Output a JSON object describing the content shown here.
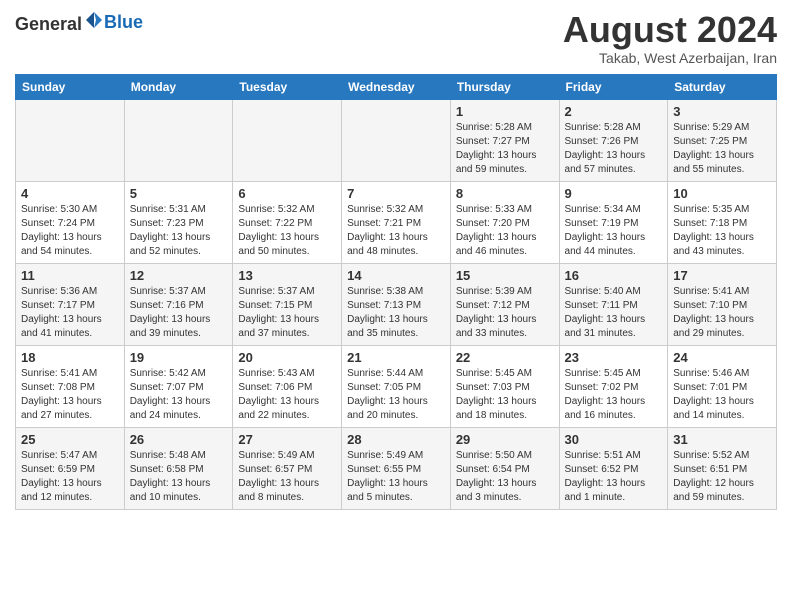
{
  "header": {
    "logo": {
      "text_general": "General",
      "text_blue": "Blue",
      "tagline": ""
    },
    "title": "August 2024",
    "location": "Takab, West Azerbaijan, Iran"
  },
  "calendar": {
    "days_of_week": [
      "Sunday",
      "Monday",
      "Tuesday",
      "Wednesday",
      "Thursday",
      "Friday",
      "Saturday"
    ],
    "weeks": [
      [
        {
          "day": "",
          "info": ""
        },
        {
          "day": "",
          "info": ""
        },
        {
          "day": "",
          "info": ""
        },
        {
          "day": "",
          "info": ""
        },
        {
          "day": "1",
          "info": "Sunrise: 5:28 AM\nSunset: 7:27 PM\nDaylight: 13 hours\nand 59 minutes."
        },
        {
          "day": "2",
          "info": "Sunrise: 5:28 AM\nSunset: 7:26 PM\nDaylight: 13 hours\nand 57 minutes."
        },
        {
          "day": "3",
          "info": "Sunrise: 5:29 AM\nSunset: 7:25 PM\nDaylight: 13 hours\nand 55 minutes."
        }
      ],
      [
        {
          "day": "4",
          "info": "Sunrise: 5:30 AM\nSunset: 7:24 PM\nDaylight: 13 hours\nand 54 minutes."
        },
        {
          "day": "5",
          "info": "Sunrise: 5:31 AM\nSunset: 7:23 PM\nDaylight: 13 hours\nand 52 minutes."
        },
        {
          "day": "6",
          "info": "Sunrise: 5:32 AM\nSunset: 7:22 PM\nDaylight: 13 hours\nand 50 minutes."
        },
        {
          "day": "7",
          "info": "Sunrise: 5:32 AM\nSunset: 7:21 PM\nDaylight: 13 hours\nand 48 minutes."
        },
        {
          "day": "8",
          "info": "Sunrise: 5:33 AM\nSunset: 7:20 PM\nDaylight: 13 hours\nand 46 minutes."
        },
        {
          "day": "9",
          "info": "Sunrise: 5:34 AM\nSunset: 7:19 PM\nDaylight: 13 hours\nand 44 minutes."
        },
        {
          "day": "10",
          "info": "Sunrise: 5:35 AM\nSunset: 7:18 PM\nDaylight: 13 hours\nand 43 minutes."
        }
      ],
      [
        {
          "day": "11",
          "info": "Sunrise: 5:36 AM\nSunset: 7:17 PM\nDaylight: 13 hours\nand 41 minutes."
        },
        {
          "day": "12",
          "info": "Sunrise: 5:37 AM\nSunset: 7:16 PM\nDaylight: 13 hours\nand 39 minutes."
        },
        {
          "day": "13",
          "info": "Sunrise: 5:37 AM\nSunset: 7:15 PM\nDaylight: 13 hours\nand 37 minutes."
        },
        {
          "day": "14",
          "info": "Sunrise: 5:38 AM\nSunset: 7:13 PM\nDaylight: 13 hours\nand 35 minutes."
        },
        {
          "day": "15",
          "info": "Sunrise: 5:39 AM\nSunset: 7:12 PM\nDaylight: 13 hours\nand 33 minutes."
        },
        {
          "day": "16",
          "info": "Sunrise: 5:40 AM\nSunset: 7:11 PM\nDaylight: 13 hours\nand 31 minutes."
        },
        {
          "day": "17",
          "info": "Sunrise: 5:41 AM\nSunset: 7:10 PM\nDaylight: 13 hours\nand 29 minutes."
        }
      ],
      [
        {
          "day": "18",
          "info": "Sunrise: 5:41 AM\nSunset: 7:08 PM\nDaylight: 13 hours\nand 27 minutes."
        },
        {
          "day": "19",
          "info": "Sunrise: 5:42 AM\nSunset: 7:07 PM\nDaylight: 13 hours\nand 24 minutes."
        },
        {
          "day": "20",
          "info": "Sunrise: 5:43 AM\nSunset: 7:06 PM\nDaylight: 13 hours\nand 22 minutes."
        },
        {
          "day": "21",
          "info": "Sunrise: 5:44 AM\nSunset: 7:05 PM\nDaylight: 13 hours\nand 20 minutes."
        },
        {
          "day": "22",
          "info": "Sunrise: 5:45 AM\nSunset: 7:03 PM\nDaylight: 13 hours\nand 18 minutes."
        },
        {
          "day": "23",
          "info": "Sunrise: 5:45 AM\nSunset: 7:02 PM\nDaylight: 13 hours\nand 16 minutes."
        },
        {
          "day": "24",
          "info": "Sunrise: 5:46 AM\nSunset: 7:01 PM\nDaylight: 13 hours\nand 14 minutes."
        }
      ],
      [
        {
          "day": "25",
          "info": "Sunrise: 5:47 AM\nSunset: 6:59 PM\nDaylight: 13 hours\nand 12 minutes."
        },
        {
          "day": "26",
          "info": "Sunrise: 5:48 AM\nSunset: 6:58 PM\nDaylight: 13 hours\nand 10 minutes."
        },
        {
          "day": "27",
          "info": "Sunrise: 5:49 AM\nSunset: 6:57 PM\nDaylight: 13 hours\nand 8 minutes."
        },
        {
          "day": "28",
          "info": "Sunrise: 5:49 AM\nSunset: 6:55 PM\nDaylight: 13 hours\nand 5 minutes."
        },
        {
          "day": "29",
          "info": "Sunrise: 5:50 AM\nSunset: 6:54 PM\nDaylight: 13 hours\nand 3 minutes."
        },
        {
          "day": "30",
          "info": "Sunrise: 5:51 AM\nSunset: 6:52 PM\nDaylight: 13 hours\nand 1 minute."
        },
        {
          "day": "31",
          "info": "Sunrise: 5:52 AM\nSunset: 6:51 PM\nDaylight: 12 hours\nand 59 minutes."
        }
      ]
    ]
  }
}
